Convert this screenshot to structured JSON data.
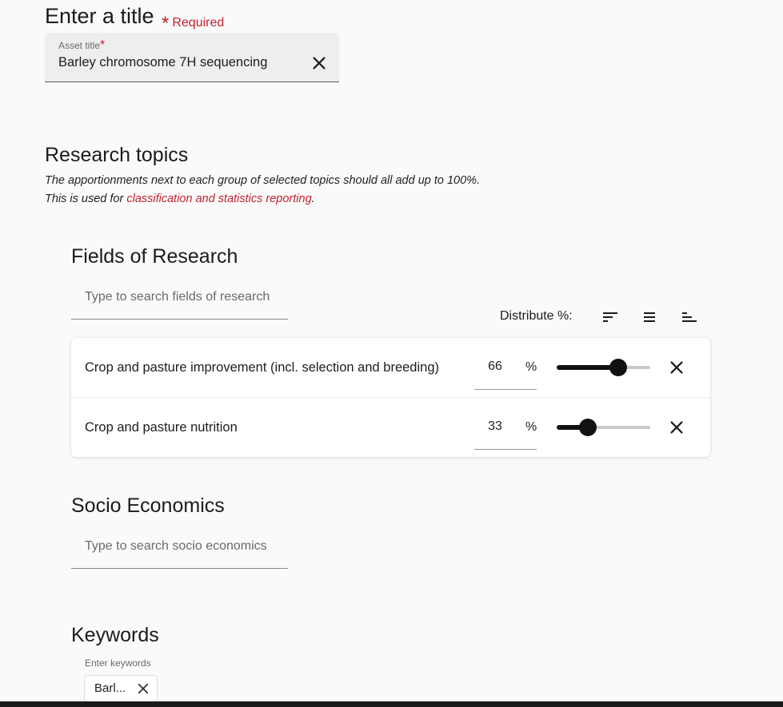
{
  "title_section": {
    "heading": "Enter a title",
    "required_label": "Required",
    "field_label": "Asset title",
    "field_value": "Barley chromosome 7H sequencing"
  },
  "research_topics": {
    "heading": "Research topics",
    "desc_line1": "The apportionments next to each group of selected topics should all add up to 100%.",
    "desc_line2_prefix": "This is used for ",
    "desc_link": "classification and statistics reporting",
    "desc_line2_suffix": "."
  },
  "fields_of_research": {
    "heading": "Fields of Research",
    "search_placeholder": "Type to search fields of research",
    "distribute_label": "Distribute %:",
    "rows": [
      {
        "name": "Crop and pasture improvement (incl. selection and breeding)",
        "percent": "66",
        "unit": "%",
        "slider_value": 0.66
      },
      {
        "name": "Crop and pasture nutrition",
        "percent": "33",
        "unit": "%",
        "slider_value": 0.33
      }
    ]
  },
  "socio_economics": {
    "heading": "Socio Economics",
    "search_placeholder": "Type to search socio economics"
  },
  "keywords": {
    "heading": "Keywords",
    "field_label": "Enter keywords",
    "chips": [
      "Barl..."
    ]
  },
  "colors": {
    "accent_red": "#c2222e",
    "background": "#fafafa"
  }
}
